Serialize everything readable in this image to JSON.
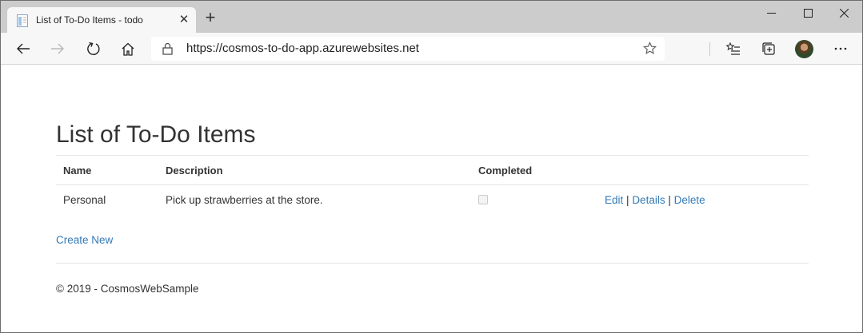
{
  "browser": {
    "tab": {
      "title": "List of To-Do Items - todo",
      "close_glyph": "✕",
      "favicon": "page-icon"
    },
    "new_tab_glyph": "+",
    "window_controls": [
      "minimize-icon",
      "maximize-icon",
      "close-icon"
    ],
    "toolbar_icons": [
      "back-arrow-icon",
      "forward-arrow-icon",
      "refresh-icon",
      "home-icon",
      "lock-icon",
      "favorite-star-icon",
      "favorites-list-icon",
      "collections-icon",
      "profile-avatar",
      "more-options-icon"
    ],
    "address": {
      "url": "https://cosmos-to-do-app.azurewebsites.net"
    },
    "colors": {
      "tabstrip": "#cccccc",
      "toolbar": "#f7f7f7",
      "link": "#337ab7"
    }
  },
  "page": {
    "title": "List of To-Do Items",
    "table": {
      "headers": [
        "Name",
        "Description",
        "Completed"
      ],
      "rows": [
        {
          "name": "Personal",
          "description": "Pick up strawberries at the store.",
          "completed": false,
          "actions": {
            "edit": "Edit",
            "details": "Details",
            "delete": "Delete",
            "separator": "|"
          }
        }
      ]
    },
    "create_new": "Create New",
    "footer": "© 2019 - CosmosWebSample"
  }
}
